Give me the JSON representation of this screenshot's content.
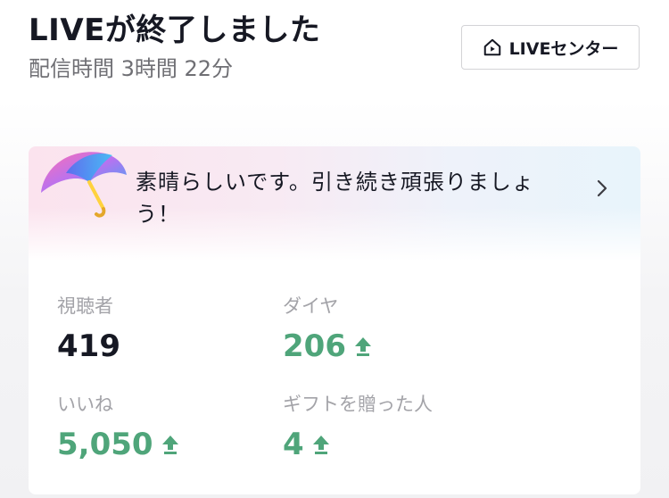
{
  "header": {
    "title": "LIVEが終了しました",
    "subtitle": "配信時間 3時間 22分"
  },
  "center_button": {
    "label": "LIVEセンター",
    "icon": "home-play-icon"
  },
  "banner": {
    "icon": "umbrella-icon",
    "message": "素晴らしいです。引き続き頑張りましょう！",
    "chevron": "chevron-right-icon"
  },
  "stats": {
    "viewers": {
      "label": "視聴者",
      "value": "419"
    },
    "diamonds": {
      "label": "ダイヤ",
      "value": "206",
      "trend": "up"
    },
    "likes": {
      "label": "いいね",
      "value": "5,050",
      "trend": "up"
    },
    "gifters": {
      "label": "ギフトを贈った人",
      "value": "4",
      "trend": "up"
    }
  },
  "colors": {
    "positive": "#4fa57a",
    "label": "#a3a3a8",
    "text": "#161823"
  }
}
